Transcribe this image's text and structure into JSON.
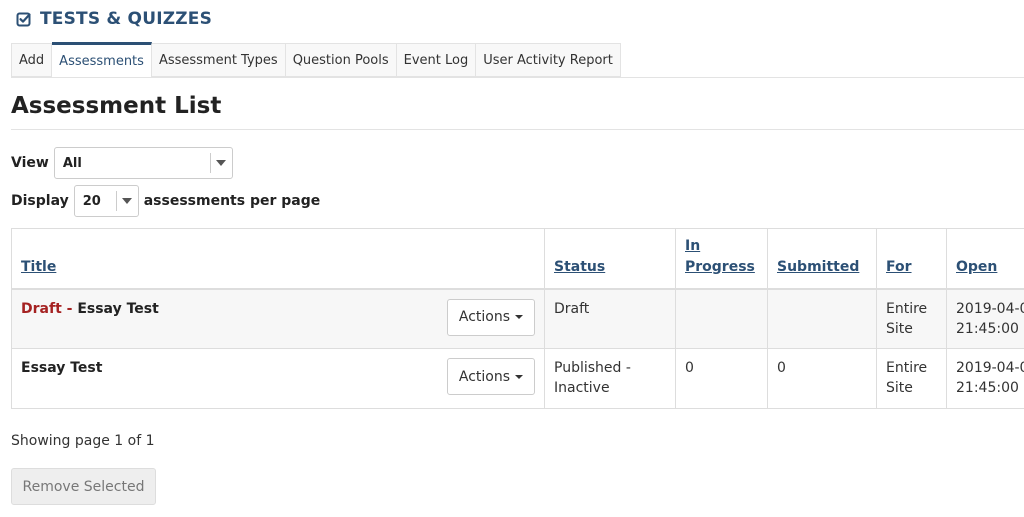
{
  "tool": {
    "icon": "check-square-icon",
    "title": "TESTS & QUIZZES"
  },
  "tabs": [
    {
      "label": "Add",
      "active": false
    },
    {
      "label": "Assessments",
      "active": true
    },
    {
      "label": "Assessment Types",
      "active": false
    },
    {
      "label": "Question Pools",
      "active": false
    },
    {
      "label": "Event Log",
      "active": false
    },
    {
      "label": "User Activity Report",
      "active": false
    }
  ],
  "page_title": "Assessment List",
  "view": {
    "label": "View",
    "selected": "All"
  },
  "display": {
    "label": "Display",
    "selected": "20",
    "suffix": "assessments per page"
  },
  "table": {
    "columns": [
      "Title",
      "Status",
      "In Progress",
      "Submitted",
      "For",
      "Open"
    ],
    "rows": [
      {
        "prefix": "Draft - ",
        "title": "Essay Test",
        "actions_label": "Actions",
        "status": "Draft",
        "in_progress": "",
        "submitted": "",
        "for": "Entire Site",
        "open": "2019-04-0 21:45:00"
      },
      {
        "prefix": "",
        "title": "Essay Test",
        "actions_label": "Actions",
        "status": "Published - Inactive",
        "in_progress": "0",
        "submitted": "0",
        "for": "Entire Site",
        "open": "2019-04-0 21:45:00"
      }
    ]
  },
  "pagination": {
    "text": "Showing page 1 of 1"
  },
  "remove_button": {
    "label": "Remove Selected",
    "disabled": true
  },
  "colors": {
    "brand": "#2c5075",
    "draft": "#a52222"
  }
}
